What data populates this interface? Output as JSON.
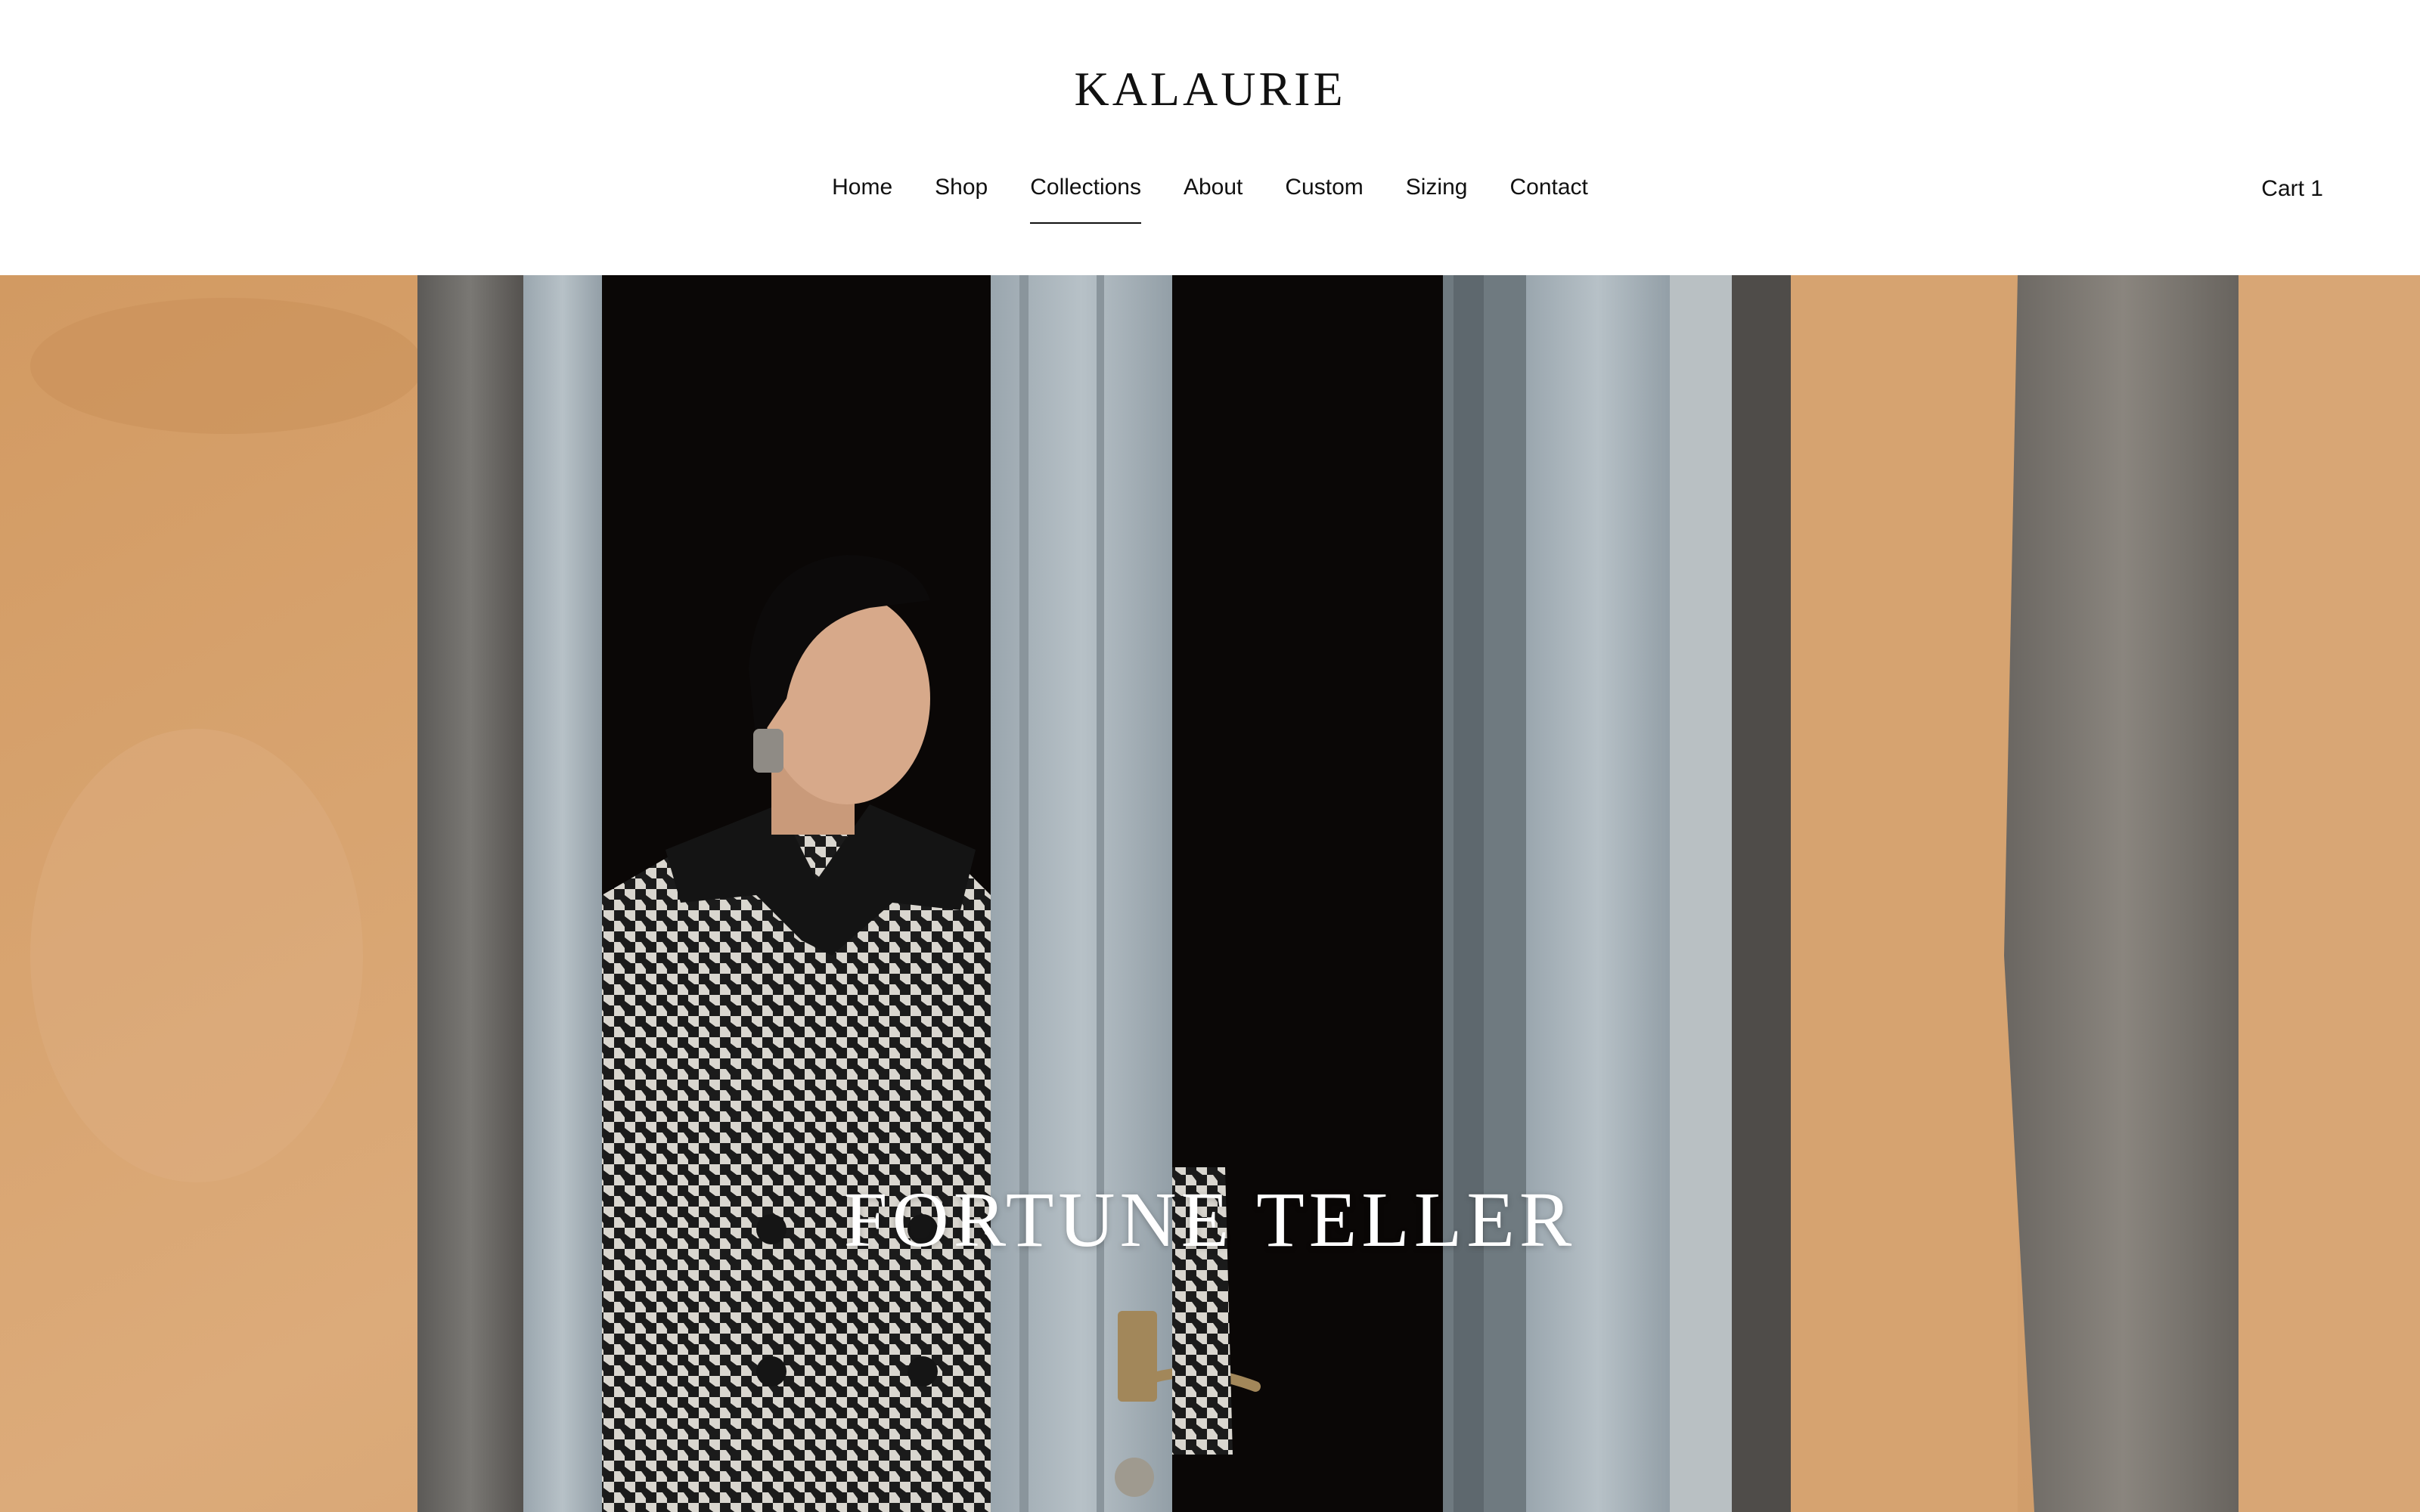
{
  "brand": {
    "name": "KALAURIE"
  },
  "nav": {
    "items": [
      {
        "label": "Home",
        "active": false
      },
      {
        "label": "Shop",
        "active": false
      },
      {
        "label": "Collections",
        "active": true
      },
      {
        "label": "About",
        "active": false
      },
      {
        "label": "Custom",
        "active": false
      },
      {
        "label": "Sizing",
        "active": false
      },
      {
        "label": "Contact",
        "active": false
      }
    ]
  },
  "cart": {
    "label": "Cart 1"
  },
  "hero": {
    "title": "FORTUNE TELLER",
    "image_alt": "Model in houndstooth coat standing in a doorway"
  },
  "colors": {
    "background": "#ffffff",
    "text": "#111111",
    "hero_title": "#ffffff",
    "wall": "#d7a370",
    "doorway": "#0a0706",
    "door_frame": "#a9b4bb"
  }
}
